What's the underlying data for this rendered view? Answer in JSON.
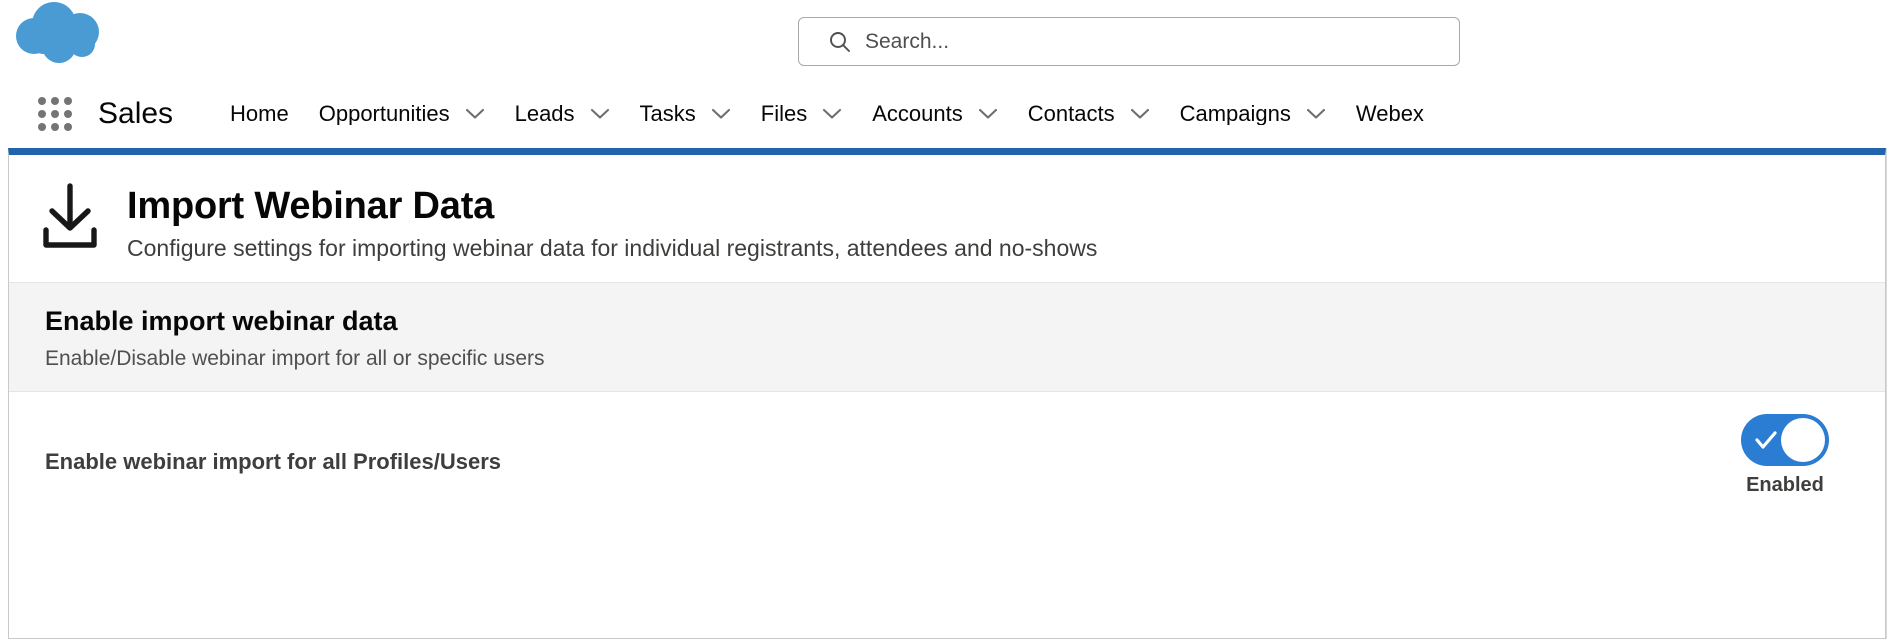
{
  "colors": {
    "cloud_blue": "#4a9ad4",
    "panel_top_border": "#1f64ad",
    "toggle_on": "#2b7cd3",
    "section_strip_bg": "#f4f4f4",
    "text_primary": "#080707",
    "text_secondary": "#3e3e3c"
  },
  "header": {
    "logo_icon": "salesforce-cloud-icon",
    "app_launcher_icon": "app-launcher-grid-icon",
    "app_name": "Sales",
    "search": {
      "icon": "search-icon",
      "placeholder": "Search...",
      "value": ""
    },
    "nav_items": [
      {
        "label": "Home",
        "has_dropdown": false
      },
      {
        "label": "Opportunities",
        "has_dropdown": true
      },
      {
        "label": "Leads",
        "has_dropdown": true
      },
      {
        "label": "Tasks",
        "has_dropdown": true
      },
      {
        "label": "Files",
        "has_dropdown": true
      },
      {
        "label": "Accounts",
        "has_dropdown": true
      },
      {
        "label": "Contacts",
        "has_dropdown": true
      },
      {
        "label": "Campaigns",
        "has_dropdown": true
      },
      {
        "label": "Webex",
        "has_dropdown": false
      }
    ]
  },
  "panel": {
    "icon": "download-icon",
    "title": "Import Webinar Data",
    "subtitle": "Configure settings for importing webinar data for individual registrants, attendees and no-shows",
    "section": {
      "title": "Enable import webinar data",
      "description": "Enable/Disable webinar import for all or specific users"
    },
    "setting": {
      "label": "Enable webinar import for all Profiles/Users",
      "toggle": {
        "state": "on",
        "status_label": "Enabled",
        "check_icon": "checkmark-icon"
      }
    }
  }
}
